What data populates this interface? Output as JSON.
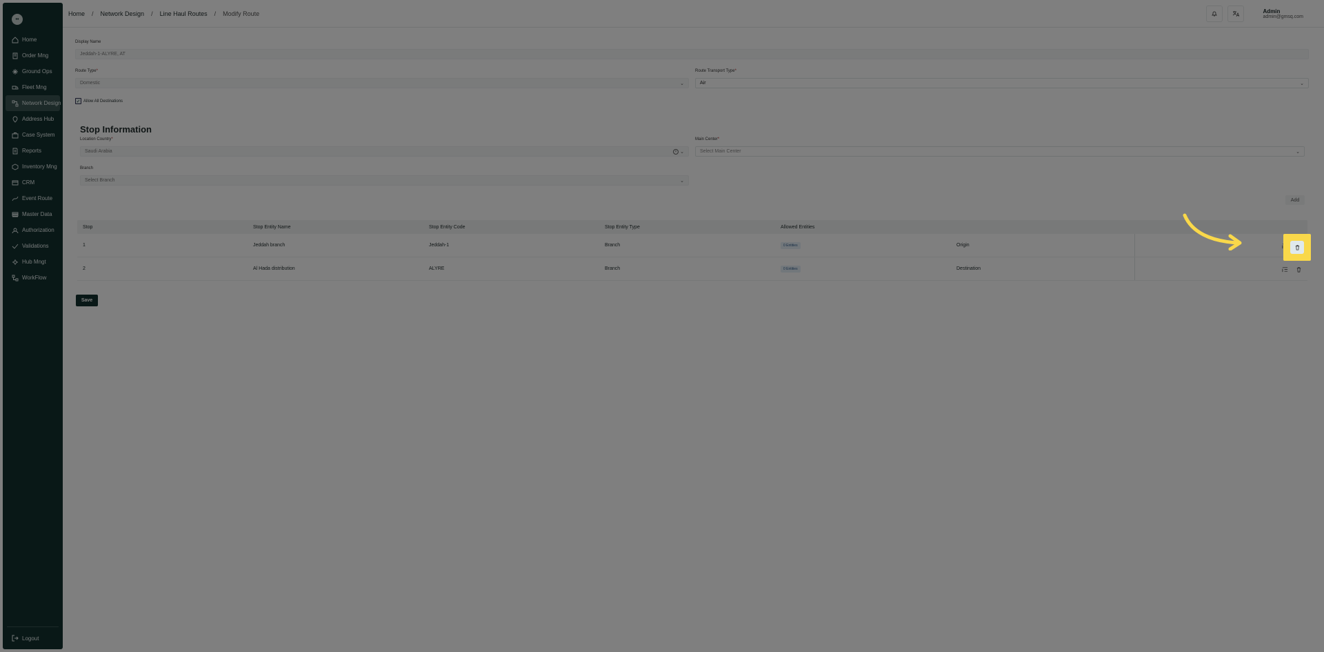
{
  "sidebar": {
    "logo": "••",
    "items": [
      {
        "label": "Home",
        "icon": "home-icon"
      },
      {
        "label": "Order Mng",
        "icon": "order-icon"
      },
      {
        "label": "Ground Ops",
        "icon": "ground-ops-icon"
      },
      {
        "label": "Fleet Mng",
        "icon": "truck-icon"
      },
      {
        "label": "Network Design",
        "icon": "network-icon",
        "active": true
      },
      {
        "label": "Address Hub",
        "icon": "address-icon"
      },
      {
        "label": "Case System",
        "icon": "case-icon"
      },
      {
        "label": "Reports",
        "icon": "reports-icon"
      },
      {
        "label": "Inventory Mng",
        "icon": "inventory-icon"
      },
      {
        "label": "CRM",
        "icon": "crm-icon"
      },
      {
        "label": "Event Route",
        "icon": "event-route-icon"
      },
      {
        "label": "Master Data",
        "icon": "database-icon"
      },
      {
        "label": "Authorization",
        "icon": "user-lock-icon"
      },
      {
        "label": "Validations",
        "icon": "validation-icon"
      },
      {
        "label": "Hub Mngt",
        "icon": "hub-icon"
      },
      {
        "label": "WorkFlow",
        "icon": "workflow-icon"
      }
    ],
    "logout": "Logout"
  },
  "header": {
    "breadcrumbs": [
      "Home",
      "Network Design",
      "Line Haul Routes",
      "Modify Route"
    ],
    "user_name": "Admin",
    "user_email": "admin@gmsq.com"
  },
  "form": {
    "display_name_label": "Display Name",
    "display_name_value": "Jeddah-1-ALYRE, AT",
    "route_type_label": "Route Type",
    "route_type_value": "Domestic",
    "transport_type_label": "Route Transport Type",
    "transport_type_value": "Air",
    "allow_all_label": "Allow All Destinations"
  },
  "stop_info": {
    "title": "Stop Information",
    "location_country_label": "Location Country",
    "location_country_value": "Saudi Arabia",
    "main_center_label": "Main Center",
    "main_center_placeholder": "Select Main Center",
    "branch_label": "Branch",
    "branch_placeholder": "Select Branch",
    "add_label": "Add"
  },
  "table": {
    "headers": [
      "Stop",
      "Stop Entity Name",
      "Stop Entity Code",
      "Stop Entity Type",
      "Allowed Entities"
    ],
    "rows": [
      {
        "stop": "1",
        "name": "Jeddah branch",
        "code": "Jeddah-1",
        "type": "Branch",
        "allowed": "0 Entities",
        "position": "Origin"
      },
      {
        "stop": "2",
        "name": "Al Hada distribution",
        "code": "ALYRE",
        "type": "Branch",
        "allowed": "0 Entities",
        "position": "Destination"
      }
    ]
  },
  "save_label": "Save",
  "colors": {
    "sidebar": "#13312f",
    "highlight": "#f9d84a"
  }
}
